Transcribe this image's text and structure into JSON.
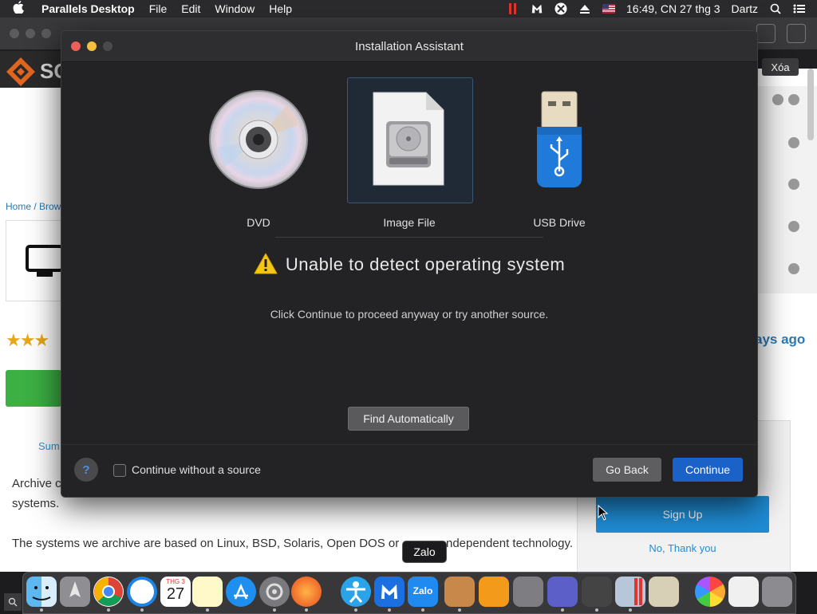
{
  "menubar": {
    "app_name": "Parallels Desktop",
    "menus": [
      "File",
      "Edit",
      "Window",
      "Help"
    ],
    "clock": "16:49, CN 27 thg 3",
    "user": "Dartz"
  },
  "browser_bg": {
    "logo_text": "SC",
    "breadcrumb": "Home / Brow",
    "clear_button": "Xóa",
    "days_ago": "ays ago",
    "summary_tab": "Sum",
    "body_line1": "Archive c",
    "body_line2": "systems.",
    "body_line3": "The systems we archive are based on Linux, BSD, Solaris, Open DOS or",
    "body_line3b": "ndependent technology.",
    "signup_label": "Sign Up",
    "nothanks_label": "No, Thank you",
    "panel_title_fragment": "t"
  },
  "dialog": {
    "title": "Installation Assistant",
    "sources": [
      {
        "label": "DVD",
        "icon": "dvd-icon",
        "selected": false
      },
      {
        "label": "Image File",
        "icon": "image-file-icon",
        "selected": true
      },
      {
        "label": "USB Drive",
        "icon": "usb-drive-icon",
        "selected": false
      }
    ],
    "warning_title": "Unable to detect operating system",
    "warning_sub": "Click Continue to proceed anyway or try another source.",
    "find_button": "Find Automatically",
    "help_label": "?",
    "checkbox_label": "Continue without a source",
    "checkbox_checked": false,
    "back_button": "Go Back",
    "continue_button": "Continue"
  },
  "tooltip": "Zalo",
  "dock": {
    "calendar_day": "27",
    "calendar_month": "THG 3",
    "zalo_label": "Zalo"
  },
  "colors": {
    "accent_blue": "#1b62c8",
    "warning_yellow": "#f5c518"
  }
}
